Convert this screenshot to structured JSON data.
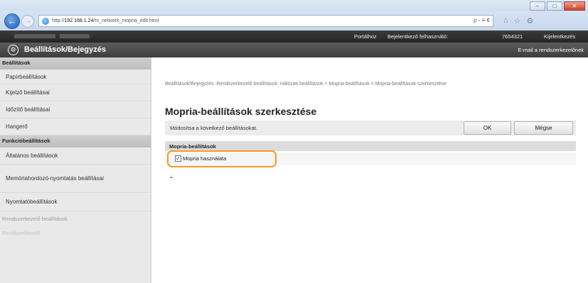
{
  "browser": {
    "url_prefix": "http://",
    "url_host": "192.168.1.24",
    "url_path": "/m_network_mopria_edit.html",
    "address_tools": "ρ - ≡ ¢",
    "toolbar_icons": [
      "⌂",
      "☆",
      "⚙"
    ],
    "window_controls": [
      "–",
      "□",
      "✕"
    ]
  },
  "userbar": {
    "portal": "Portálhoz",
    "logged_in_label": "Bejelentkező felhasználó:",
    "user_id": "7654321",
    "logout": "Kijelentkezés"
  },
  "header": {
    "icon": "gear-icon",
    "title": "Beállítások/Bejegyzés",
    "mail_link": "E-mail a rendszerkezelőnek"
  },
  "sidebar": {
    "group_settings": "Beállítások",
    "items_settings": [
      "Papírbeállítások",
      "Kijelző beállításai",
      "Időzítő beállításai",
      "Hangerő"
    ],
    "group_functions": "Funkcióbeállítások",
    "items_functions": [
      "Általános beállítások",
      "Memóriahordozó-nyomtatás beállításai",
      "Nyomtatóbeállítások"
    ],
    "faded_items": [
      "Rendszerkezelő beállítások",
      "Rendszerkezelő"
    ]
  },
  "main": {
    "breadcrumb": "Beállítások/Bejegyzés: Rendszerkezelő beállítások: Hálózati beállítások > Mopria-beállítások > Mopria-beállítások szerkesztése",
    "title": "Mopria-beállítások szerkesztése",
    "prompt": "Módosítsa a következő beállításokat.",
    "ok_label": "OK",
    "cancel_label": "Mégse",
    "section": "Mopria-beállítások",
    "checkbox_label": "Mopria használata",
    "checkbox_checked": true,
    "highlight_color": "#f29a27",
    "top_icon": "to-top-icon"
  }
}
